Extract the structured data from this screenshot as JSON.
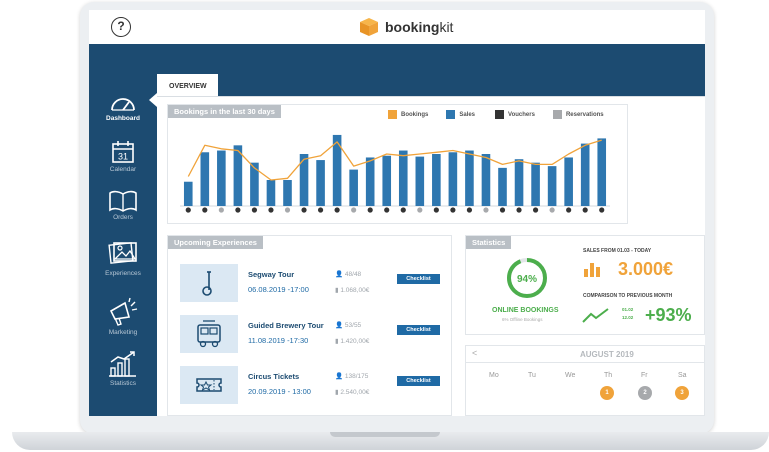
{
  "app": {
    "brand_bold": "booking",
    "brand_light": "kit",
    "help_icon": "question-mark-icon"
  },
  "sidebar": {
    "items": [
      {
        "label": "Dashboard",
        "icon": "gauge-icon",
        "active": true
      },
      {
        "label": "Calendar",
        "icon": "calendar-icon",
        "calendar_day": "31"
      },
      {
        "label": "Orders",
        "icon": "book-icon"
      },
      {
        "label": "Experiences",
        "icon": "photos-icon"
      },
      {
        "label": "Marketing",
        "icon": "megaphone-icon"
      },
      {
        "label": "Statistics",
        "icon": "trend-chart-icon"
      }
    ]
  },
  "tabs": [
    {
      "label": "OVERVIEW"
    }
  ],
  "bookings_card": {
    "title": "Bookings in the last 30 days"
  },
  "chart_data": {
    "type": "bar",
    "title": "Bookings in the last 30 days",
    "legend": [
      {
        "name": "Bookings",
        "color": "#f0a33a"
      },
      {
        "name": "Sales",
        "color": "#2e77b0"
      },
      {
        "name": "Vouchers",
        "color": "#333333"
      },
      {
        "name": "Reservations",
        "color": "#a7a9ac"
      }
    ],
    "series": [
      {
        "name": "Sales",
        "color": "#2e77b0",
        "values": [
          28,
          62,
          64,
          70,
          50,
          30,
          30,
          60,
          53,
          82,
          42,
          56,
          58,
          64,
          57,
          60,
          62,
          64,
          60,
          44,
          54,
          50,
          46,
          56,
          72,
          78
        ]
      },
      {
        "name": "Bookings",
        "color": "#f0a33a",
        "values": [
          34,
          70,
          66,
          64,
          44,
          30,
          32,
          54,
          58,
          74,
          46,
          52,
          60,
          58,
          60,
          62,
          64,
          60,
          56,
          48,
          52,
          48,
          48,
          60,
          70,
          76
        ]
      }
    ],
    "ylim": [
      0,
      90
    ],
    "grid": false
  },
  "experiences_card": {
    "title": "Upcoming Experiences",
    "rows": [
      {
        "name": "Segway Tour",
        "date": "06.08.2019 -17:00",
        "seats": "48/48",
        "revenue": "1.068,00€",
        "button": "Checklist",
        "icon": "segway-icon"
      },
      {
        "name": "Guided Brewery Tour",
        "date": "11.08.2019 -17:30",
        "seats": "53/55",
        "revenue": "1.420,00€",
        "button": "Checklist",
        "icon": "bus-icon"
      },
      {
        "name": "Circus  Tickets",
        "date": "20.09.2019 - 13:00",
        "seats": "138/175",
        "revenue": "2.540,00€",
        "button": "Checklist",
        "icon": "ticket-icon"
      }
    ]
  },
  "statistics_card": {
    "title": "Statistics",
    "online_percent_label": "94%",
    "online_fraction": 0.94,
    "online_label": "ONLINE BOOKINGS",
    "offline_label": "6% Offline Bookings",
    "sales_from_label": "SALES FROM 01.03 - TODAY",
    "sales_value": "3.000€",
    "comparison_label": "COMPARISON TO PREVIOUS MONTH",
    "comparison_from": "01.02",
    "comparison_to": "12.02",
    "comparison_value": "+93%",
    "colors": {
      "green": "#4cae4c",
      "orange": "#f0a33a"
    }
  },
  "calendar": {
    "prev_label": "<",
    "month": "AUGUST 2019",
    "days": [
      "Mo",
      "Tu",
      "We",
      "Th",
      "Fr",
      "Sa"
    ],
    "markers": [
      {
        "day": "Th",
        "value": "1",
        "color": "#f0a33a"
      },
      {
        "day": "Fr",
        "value": "2",
        "color": "#a7a9ac"
      },
      {
        "day": "Sa",
        "value": "3",
        "color": "#f0a33a"
      }
    ]
  }
}
